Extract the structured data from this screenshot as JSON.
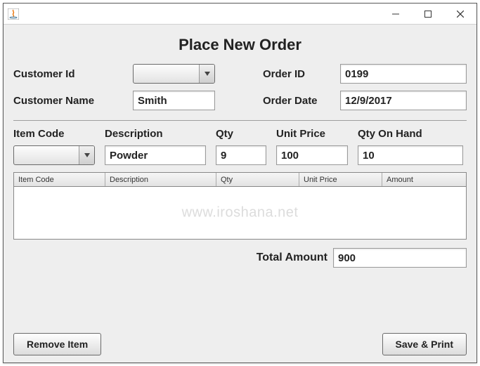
{
  "window": {
    "title": ""
  },
  "heading": "Place New Order",
  "form": {
    "customer_id_label": "Customer Id",
    "customer_id_value": "",
    "order_id_label": "Order ID",
    "order_id_value": "0199",
    "customer_name_label": "Customer Name",
    "customer_name_value": "Smith",
    "order_date_label": "Order Date",
    "order_date_value": "12/9/2017"
  },
  "item_header": {
    "item_code": "Item Code",
    "description": "Description",
    "qty": "Qty",
    "unit_price": "Unit Price",
    "qty_on_hand": "Qty On Hand"
  },
  "item_row": {
    "item_code_value": "",
    "description_value": "Powder",
    "qty_value": "9",
    "unit_price_value": "100",
    "qty_on_hand_value": "10"
  },
  "table": {
    "columns": [
      "Item Code",
      "Description",
      "Qty",
      "Unit Price",
      "Amount"
    ],
    "rows": []
  },
  "watermark": "www.iroshana.net",
  "total": {
    "label": "Total Amount",
    "value": "900"
  },
  "buttons": {
    "remove": "Remove Item",
    "save_print": "Save & Print"
  }
}
